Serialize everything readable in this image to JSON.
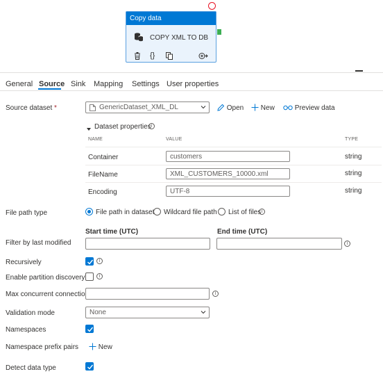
{
  "card": {
    "header": "Copy data",
    "name": "COPY XML TO DB",
    "foot_icons": [
      "delete-icon",
      "code-icon",
      "copy-icon",
      "add-output-icon"
    ]
  },
  "tabs": [
    {
      "label": "General",
      "active": false
    },
    {
      "label": "Source",
      "active": true
    },
    {
      "label": "Sink",
      "active": false
    },
    {
      "label": "Mapping",
      "active": false
    },
    {
      "label": "Settings",
      "active": false
    },
    {
      "label": "User properties",
      "active": false
    }
  ],
  "source_dataset": {
    "label": "Source dataset",
    "required_mark": "*",
    "value": "GenericDataset_XML_DL",
    "open_label": "Open",
    "new_label": "New",
    "preview_label": "Preview data"
  },
  "dataset_properties": {
    "title": "Dataset properties",
    "columns": {
      "name": "NAME",
      "value": "VALUE",
      "type": "TYPE"
    },
    "rows": [
      {
        "name": "Container",
        "value": "customers",
        "type": "string"
      },
      {
        "name": "FileName",
        "value": "XML_CUSTOMERS_10000.xml",
        "type": "string"
      },
      {
        "name": "Encoding",
        "value": "UTF-8",
        "type": "string"
      }
    ]
  },
  "file_path_type": {
    "label": "File path type",
    "options": [
      {
        "label": "File path in dataset",
        "selected": true
      },
      {
        "label": "Wildcard file path",
        "selected": false
      },
      {
        "label": "List of files",
        "selected": false
      }
    ]
  },
  "filter": {
    "label": "Filter by last modified",
    "start_label": "Start time (UTC)",
    "end_label": "End time (UTC)",
    "start_value": "",
    "end_value": ""
  },
  "recursively": {
    "label": "Recursively",
    "checked": true
  },
  "partition": {
    "label": "Enable partition discovery",
    "checked": false
  },
  "max_conn": {
    "label": "Max concurrent connections",
    "value": ""
  },
  "validation": {
    "label": "Validation mode",
    "value": "None"
  },
  "namespaces": {
    "label": "Namespaces",
    "checked": true
  },
  "ns_prefix": {
    "label": "Namespace prefix pairs",
    "new_label": "New"
  },
  "detect": {
    "label": "Detect data type",
    "checked": true
  },
  "colors": {
    "accent": "#0078d4",
    "required": "#a4262c",
    "port": "#3cae54",
    "error": "#e81123"
  }
}
